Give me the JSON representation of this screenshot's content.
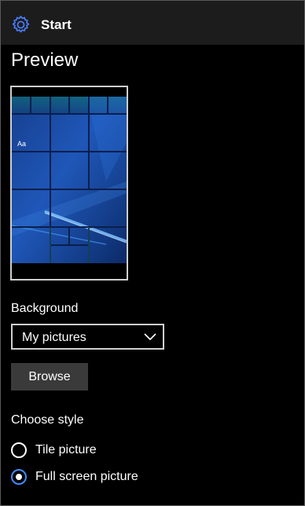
{
  "header": {
    "title": "Start",
    "icon": "gear-icon",
    "accent_color": "#4a7dff"
  },
  "preview": {
    "title": "Preview",
    "tile_label": "Aa",
    "wallpaper_color": "#1a4aa6"
  },
  "background": {
    "label": "Background",
    "selected": "My pictures",
    "browse_label": "Browse"
  },
  "style": {
    "label": "Choose style",
    "options": [
      {
        "label": "Tile picture",
        "checked": false
      },
      {
        "label": "Full screen picture",
        "checked": true
      }
    ],
    "accent_color": "#3c8dff"
  }
}
